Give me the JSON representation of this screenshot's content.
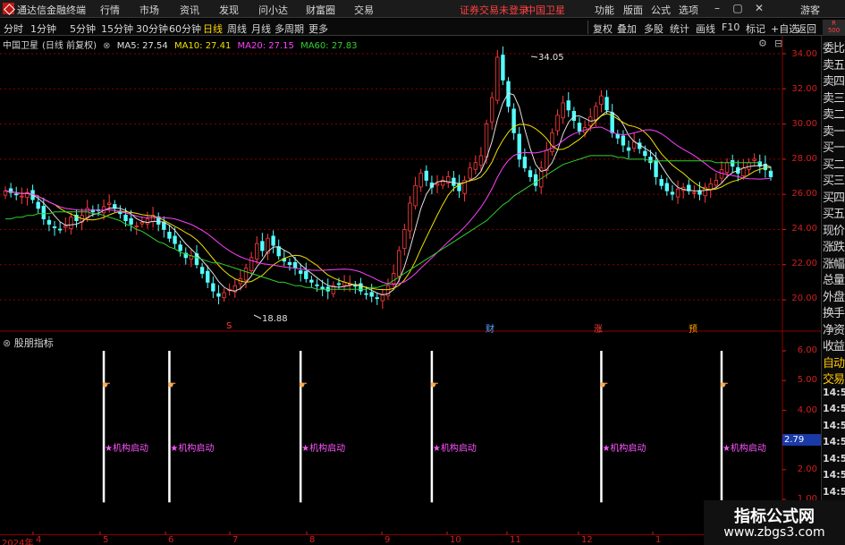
{
  "app": {
    "name": "通达信金融终端",
    "menu": [
      "行情",
      "市场",
      "资讯",
      "发现",
      "问小达",
      "财富圈",
      "交易"
    ],
    "notice": "证券交易未登录",
    "stock_title": "中国卫星",
    "right_menu": [
      "功能",
      "版面",
      "公式",
      "选项"
    ],
    "user": "游客"
  },
  "toolbar": {
    "periods": [
      "分时",
      "1分钟",
      "5分钟",
      "15分钟",
      "30分钟",
      "60分钟",
      "日线",
      "周线",
      "月线",
      "多周期",
      "更多"
    ],
    "active": "日线",
    "right_buttons": [
      "复权",
      "叠加",
      "多股",
      "统计",
      "画线",
      "F10",
      "标记",
      "+自选",
      "返回"
    ]
  },
  "chart_header": {
    "stock": "中国卫星",
    "mode": "(日线 前复权)",
    "ma5": "MA5: 27.54",
    "ma10": "MA10: 27.41",
    "ma20": "MA20: 27.15",
    "ma60": "MA60: 27.83"
  },
  "colors": {
    "up": "#ff3c3c",
    "down": "#54ffff",
    "ma5": "#e0e0e0",
    "ma10": "#f0e000",
    "ma20": "#ff40ff",
    "ma60": "#30d030",
    "grid": "#8b0000",
    "signal": "#ff55ff"
  },
  "right_panel": {
    "badge_top": "R",
    "badge_bottom": "500",
    "items": [
      "委比",
      "卖五",
      "卖四",
      "卖三",
      "卖二",
      "卖一",
      "买一",
      "买二",
      "买三",
      "买四",
      "买五",
      "现价",
      "涨跌",
      "涨幅",
      "总量",
      "外盘",
      "换手",
      "净资",
      "收益",
      "自动",
      "交易",
      "14:56",
      "14:56",
      "14:56",
      "14:56",
      "14:56",
      "14:56",
      "14:56",
      "14:56",
      "14:56"
    ]
  },
  "chart_data": {
    "type": "candlestick",
    "y_axis_labels": [
      "34.00",
      "32.00",
      "30.00",
      "28.00",
      "26.00",
      "24.00",
      "22.00",
      "20.00"
    ],
    "ylim": [
      19,
      35
    ],
    "high_annotation": "34.05",
    "low_annotation": "18.88",
    "event_markers": [
      {
        "label": "S",
        "color": "#ff3c3c"
      },
      {
        "label": "财",
        "color": "#54a8ff"
      },
      {
        "label": "涨",
        "color": "#ff3c3c"
      },
      {
        "label": "预",
        "color": "#ffa000"
      }
    ],
    "closes": [
      26.2,
      26.1,
      26.0,
      25.9,
      26.1,
      25.7,
      25.2,
      24.6,
      24.3,
      24.1,
      24.0,
      24.2,
      24.7,
      24.5,
      24.8,
      25.2,
      25.0,
      25.1,
      25.3,
      25.5,
      25.2,
      24.9,
      24.5,
      24.3,
      24.2,
      24.4,
      24.6,
      24.8,
      24.3,
      24.0,
      23.5,
      23.2,
      22.8,
      22.4,
      22.5,
      22.0,
      21.5,
      21.0,
      20.5,
      20.2,
      20.4,
      20.6,
      20.8,
      21.2,
      21.8,
      22.4,
      23.2,
      22.8,
      23.5,
      23.1,
      22.5,
      22.2,
      22.0,
      21.8,
      21.5,
      21.2,
      21.0,
      20.8,
      20.6,
      20.5,
      20.8,
      20.9,
      21.0,
      20.9,
      20.8,
      20.5,
      20.3,
      20.2,
      20.1,
      20.3,
      20.8,
      21.5,
      22.8,
      24.0,
      25.5,
      26.5,
      27.2,
      26.8,
      26.4,
      26.6,
      26.8,
      27.0,
      26.5,
      26.2,
      26.8,
      27.5,
      27.8,
      28.2,
      30.0,
      31.5,
      33.8,
      32.5,
      31.0,
      29.5,
      28.0,
      27.5,
      27.0,
      26.5,
      27.5,
      28.5,
      29.5,
      30.5,
      31.2,
      30.8,
      30.2,
      29.6,
      29.8,
      30.4,
      31.0,
      31.6,
      30.8,
      29.5,
      29.2,
      28.8,
      28.5,
      29.0,
      28.6,
      28.2,
      27.8,
      27.0,
      26.5,
      26.2,
      26.0,
      26.3,
      26.4,
      26.2,
      26.1,
      26.0,
      26.4,
      26.6,
      26.8,
      27.4,
      27.8,
      27.6,
      27.2,
      27.5,
      27.8,
      28.0,
      27.6,
      27.4,
      27.0
    ],
    "ma60": [
      24.6,
      24.6,
      24.7,
      24.7,
      24.8,
      24.8,
      24.9,
      24.9,
      24.9,
      25.0,
      25.0,
      25.0,
      25.0,
      25.0,
      25.0,
      25.0,
      24.9,
      24.9,
      24.8,
      24.7,
      24.6,
      24.5,
      24.3,
      24.2,
      24.0,
      23.9,
      23.7,
      23.5,
      23.3,
      23.2,
      23.0,
      22.9,
      22.7,
      22.6,
      22.5,
      22.4,
      22.3,
      22.2,
      22.1,
      22.1,
      22.0,
      21.9,
      21.8,
      21.7,
      21.6,
      21.5,
      21.4,
      21.3,
      21.2,
      21.1,
      21.0,
      21.0,
      20.9,
      20.8,
      20.8,
      20.7,
      20.7,
      20.6,
      20.6,
      20.6,
      20.6,
      20.6,
      20.6,
      20.6,
      20.6,
      20.6,
      20.6,
      20.7,
      20.7,
      20.8,
      20.9,
      21.1,
      21.3,
      21.5,
      21.7,
      21.9,
      22.1,
      22.3,
      22.5,
      22.7,
      22.9,
      23.1,
      23.3,
      23.5,
      23.7,
      23.9,
      24.1,
      24.3,
      24.5,
      24.8,
      25.1,
      25.4,
      25.6,
      25.9,
      26.1,
      26.3,
      26.5,
      26.7,
      26.9,
      27.1,
      27.3,
      27.5,
      27.7,
      27.8,
      27.9,
      28.0,
      28.1,
      28.2,
      28.2,
      28.2,
      28.2,
      28.2,
      28.1,
      28.1,
      28.0,
      28.0,
      28.0,
      28.0,
      27.9,
      27.9,
      27.9,
      27.9,
      27.9,
      27.9,
      27.9,
      27.9,
      27.9,
      27.9,
      27.9,
      27.9,
      27.8,
      27.8,
      27.8,
      27.8,
      27.8,
      27.8,
      27.8,
      27.8,
      27.8
    ],
    "lower_axis_labels": [
      "6.00",
      "5.00",
      "4.00",
      "3.00",
      "2.00",
      "1.00"
    ],
    "lower_ylim": [
      0.9,
      6.3
    ],
    "lower_current_value": "2.79",
    "signal_label": "★机构启动",
    "signal_positions": [
      18,
      30,
      54,
      78,
      109,
      131
    ],
    "date_labels": [
      "2024年",
      "4",
      "5",
      "6",
      "7",
      "8",
      "9",
      "10",
      "11",
      "12",
      "1"
    ]
  },
  "lower_panel": {
    "title": "股朋指标"
  },
  "watermark": {
    "line1": "指标公式网",
    "line2": "www.zbgs3.com"
  }
}
